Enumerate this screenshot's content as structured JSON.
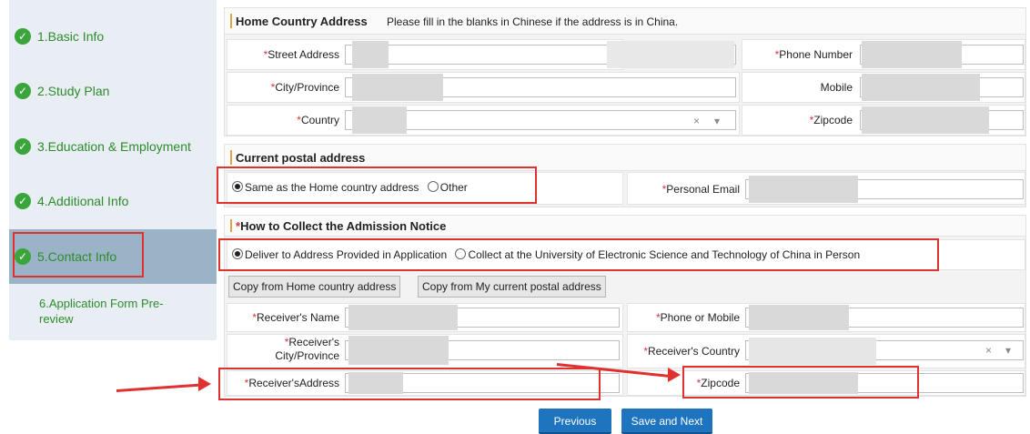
{
  "sidebar": {
    "steps": [
      {
        "label": "1.Basic Info",
        "icon": "check-circle-icon"
      },
      {
        "label": "2.Study Plan",
        "icon": "check-circle-icon"
      },
      {
        "label": "3.Education & Employment",
        "icon": "check-circle-icon"
      },
      {
        "label": "4.Additional Info",
        "icon": "check-circle-icon"
      },
      {
        "label": "5.Contact Info",
        "icon": "check-circle-icon"
      },
      {
        "label": "6.Application Form Pre-review"
      }
    ]
  },
  "home_address": {
    "title": "Home Country Address",
    "note": "Please fill in the blanks in Chinese if the address is in China.",
    "street_label": "Street Address",
    "city_label": "City/Province",
    "country_label": "Country",
    "phone_label": "Phone Number",
    "mobile_label": "Mobile",
    "zipcode_label": "Zipcode",
    "required_mark": "*"
  },
  "postal": {
    "title": "Current postal address",
    "option_same": "Same as the Home country address",
    "option_other": "Other",
    "email_label": "Personal Email"
  },
  "notice": {
    "title": "How to Collect the Admission Notice",
    "option_deliver": "Deliver to Address Provided in Application",
    "option_collect": "Collect at the University of Electronic Science and Technology of China in Person",
    "copy_home_button": "Copy from Home country address",
    "copy_postal_button": "Copy from My current postal address",
    "receiver_name_label": "Receiver's Name",
    "receiver_city_label_1": "Receiver's",
    "receiver_city_label_2": "City/Province",
    "receiver_address_label": "Receiver'sAddress",
    "phone_mobile_label": "Phone or Mobile",
    "receiver_country_label": "Receiver's Country",
    "zipcode_label": "Zipcode"
  },
  "select_clear_glyph": "×",
  "select_caret_glyph": "▾",
  "footer": {
    "previous_button": "Previous",
    "save_next_button": "Save and Next"
  },
  "colors": {
    "accent_green": "#3aa53a",
    "highlight_red": "#e03131",
    "primary_button": "#1e74bf",
    "active_step_bg": "#9bb3c6"
  }
}
